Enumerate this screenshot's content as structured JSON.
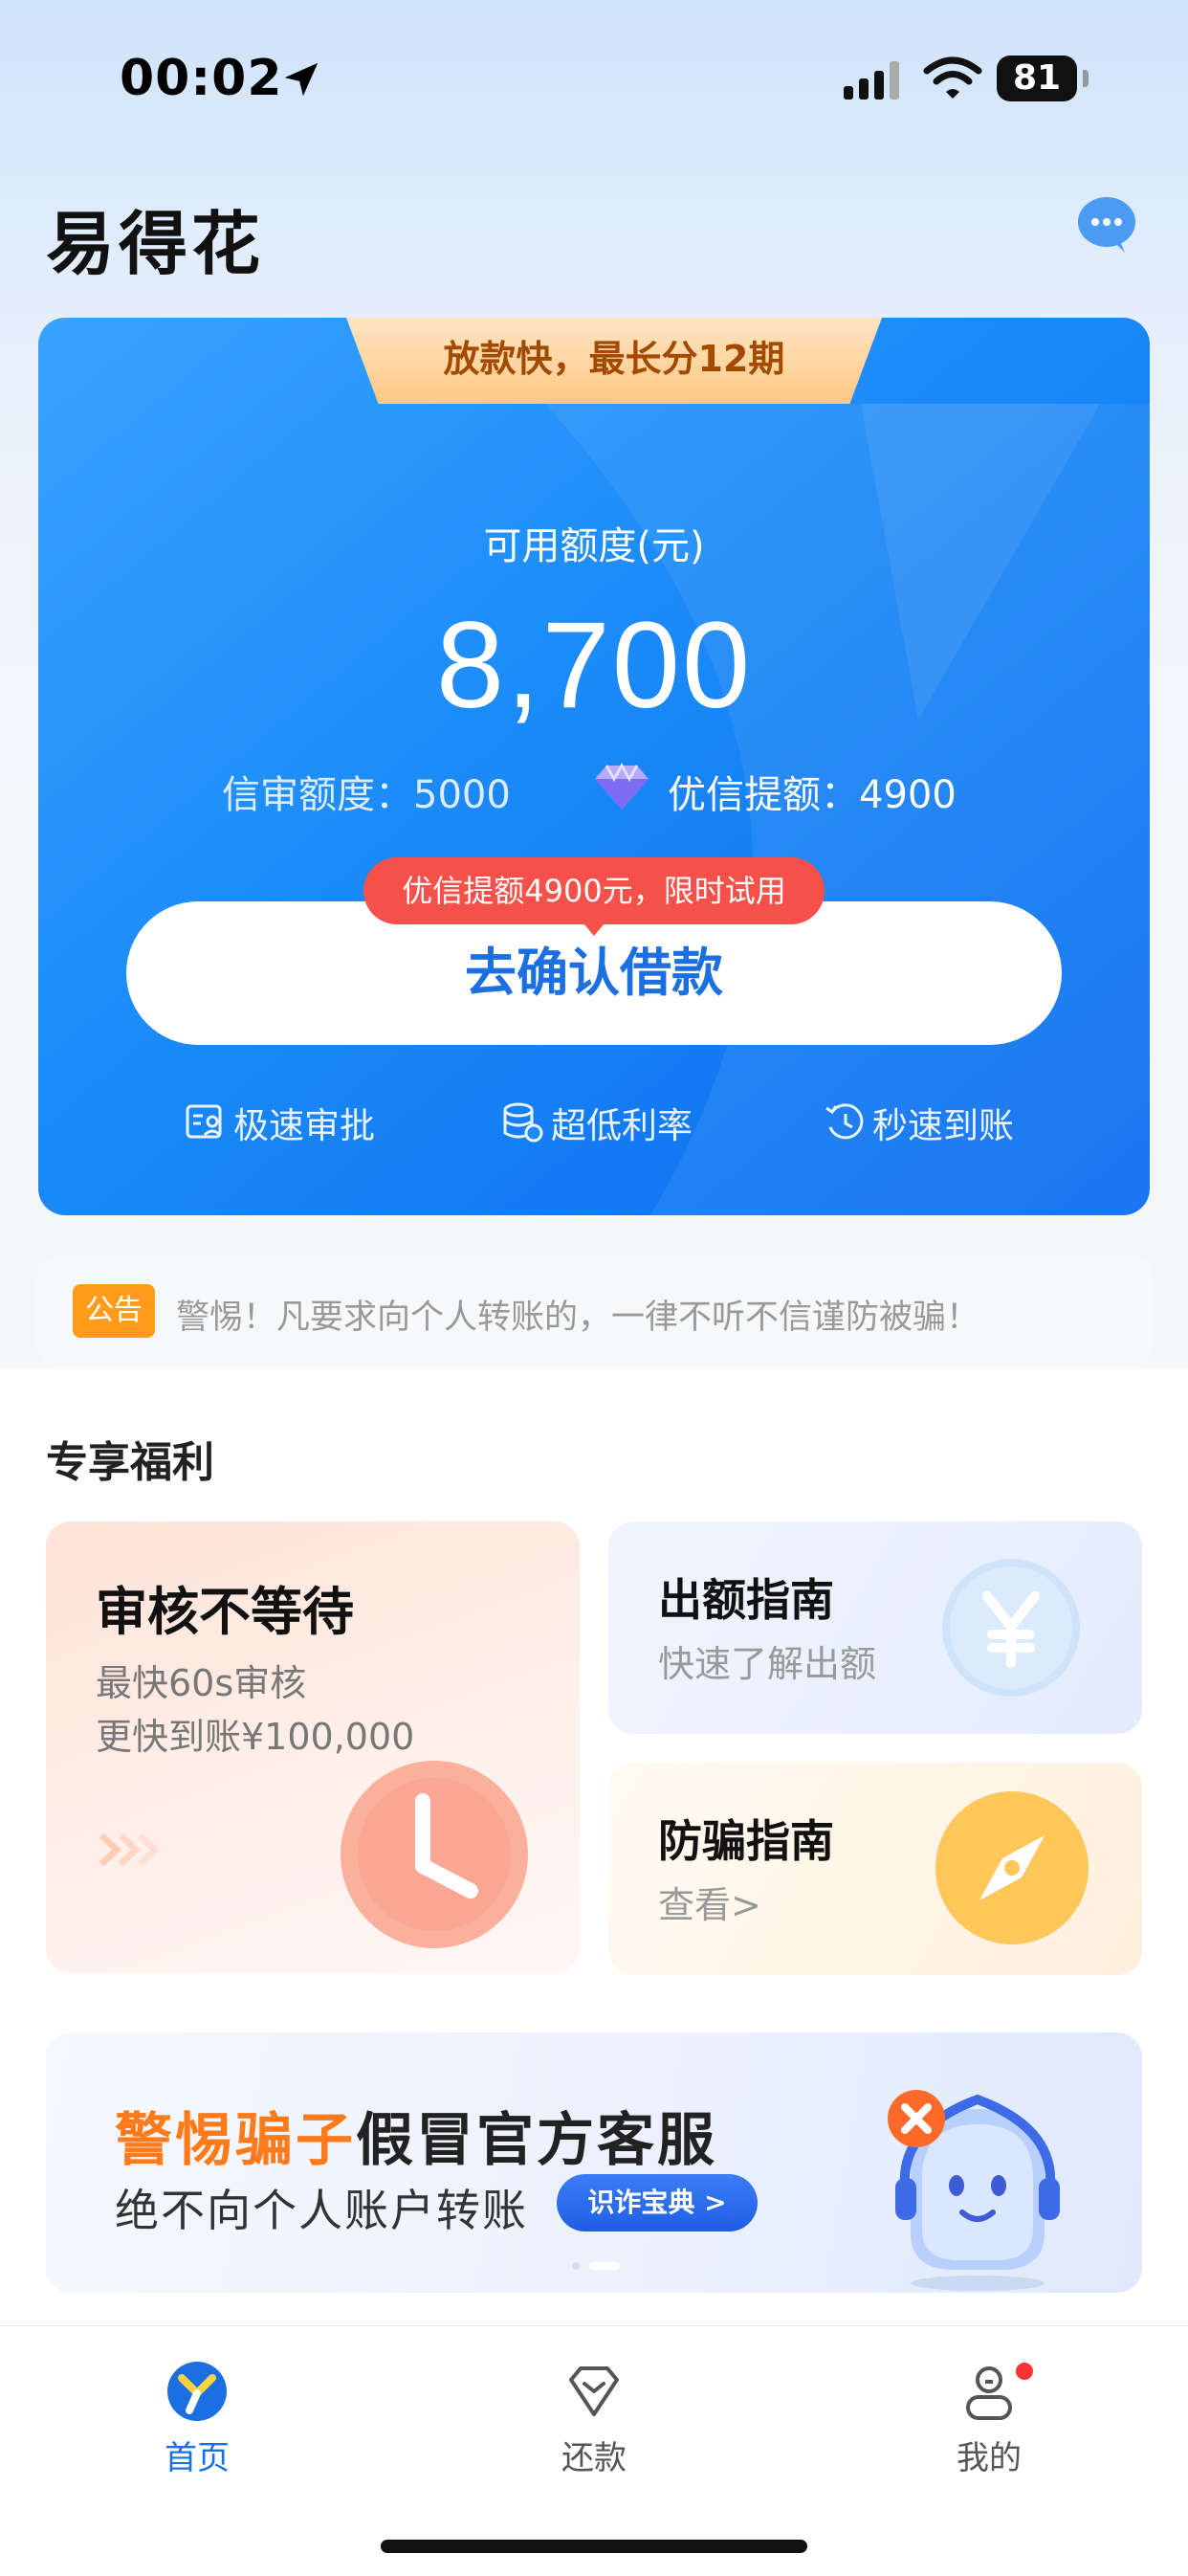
{
  "status_bar": {
    "time": "00:02",
    "battery": "81"
  },
  "header": {
    "title": "易得花",
    "chat_icon": "chat-bubble-icon"
  },
  "credit_card": {
    "promo_tab": "放款快，最长分12期",
    "available_label": "可用额度(元)",
    "available_amount": "8,700",
    "credit_quota": "信审额度：5000",
    "premium_quota": "优信提额：4900",
    "tip_badge": "优信提额4900元，限时试用",
    "confirm_button": "去确认借款",
    "features": [
      "极速审批",
      "超低利率",
      "秒速到账"
    ],
    "colors": {
      "card_start": "#38a4ff",
      "card_end": "#0a6cf0",
      "button_text": "#1b6fe0",
      "badge": "#f5504a"
    }
  },
  "notice": {
    "tag": "公告",
    "text": "警惕！凡要求向个人转账的，一律不听不信谨防被骗！"
  },
  "benefits": {
    "title": "专享福利",
    "review": {
      "title": "审核不等待",
      "line1": "最快60s审核",
      "line2": "更快到账¥100,000"
    },
    "limit_guide": {
      "title": "出额指南",
      "subtitle": "快速了解出额"
    },
    "fraud_guide": {
      "title": "防骗指南",
      "subtitle": "查看>"
    }
  },
  "banner": {
    "highlight": "警惕骗子",
    "title_rest": "假冒官方客服",
    "subtitle": "绝不向个人账户转账",
    "button": "识诈宝典 >"
  },
  "tab_bar": {
    "tabs": [
      {
        "label": "首页",
        "active": true
      },
      {
        "label": "还款",
        "active": false
      },
      {
        "label": "我的",
        "active": false,
        "has_dot": true
      }
    ],
    "active_color": "#1b6fe0"
  }
}
